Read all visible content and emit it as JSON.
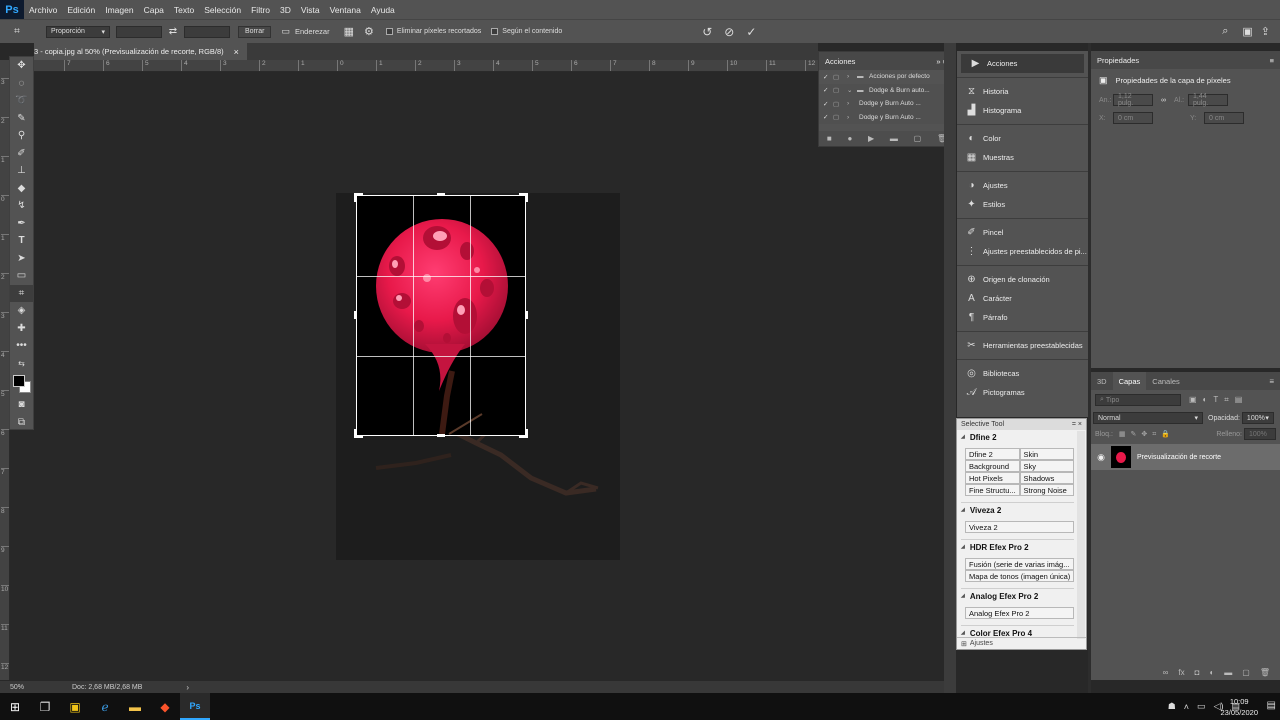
{
  "menubar": {
    "logo": "Ps",
    "items": [
      "Archivo",
      "Edición",
      "Imagen",
      "Capa",
      "Texto",
      "Selección",
      "Filtro",
      "3D",
      "Vista",
      "Ventana",
      "Ayuda"
    ]
  },
  "options": {
    "ratio": "Proporción",
    "clear": "Borrar",
    "straighten": "Enderezar",
    "delete_cropped": "Eliminar píxeles recortados",
    "content_aware": "Según el contenido"
  },
  "document": {
    "tab_title": "3 - copia.jpg al 50% (Previsualización de recorte, RGB/8)",
    "zoom": "50%",
    "doc_info": "Doc: 2,68 MB/2,68 MB"
  },
  "ruler_h": [
    "7",
    "6",
    "5",
    "4",
    "3",
    "2",
    "1",
    "0",
    "1",
    "2",
    "3",
    "4",
    "5",
    "6",
    "7",
    "8",
    "9",
    "10",
    "11",
    "12"
  ],
  "ruler_v": [
    "3",
    "2",
    "1",
    "0",
    "1",
    "2",
    "3",
    "4",
    "5",
    "6",
    "7",
    "8",
    "9",
    "10",
    "11",
    "12"
  ],
  "actions_panel": {
    "title": "Acciones",
    "items": [
      "Acciones por defecto",
      "Dodge & Burn auto...",
      "Dodge y Burn Auto ...",
      "Dodge y Burn Auto ..."
    ]
  },
  "side_panel": {
    "items": [
      {
        "label": "Acciones",
        "icon": "play-icon"
      },
      {
        "label": "Historia",
        "icon": "history-icon"
      },
      {
        "label": "Histograma",
        "icon": "histogram-icon"
      },
      {
        "label": "Color",
        "icon": "color-icon"
      },
      {
        "label": "Muestras",
        "icon": "swatches-icon"
      },
      {
        "label": "Ajustes",
        "icon": "adjustments-icon"
      },
      {
        "label": "Estilos",
        "icon": "styles-icon"
      },
      {
        "label": "Pincel",
        "icon": "brush-icon"
      },
      {
        "label": "Ajustes preestablecidos de pi...",
        "icon": "brush-presets-icon"
      },
      {
        "label": "Origen de clonación",
        "icon": "clone-source-icon"
      },
      {
        "label": "Carácter",
        "icon": "character-icon"
      },
      {
        "label": "Párrafo",
        "icon": "paragraph-icon"
      },
      {
        "label": "Herramientas preestablecidas",
        "icon": "tool-presets-icon"
      },
      {
        "label": "Bibliotecas",
        "icon": "libraries-icon"
      },
      {
        "label": "Pictogramas",
        "icon": "glyphs-icon"
      }
    ]
  },
  "properties": {
    "title": "Propiedades",
    "subtitle": "Propiedades de la capa de píxeles",
    "an_label": "An.:",
    "an_value": "1,12 pulg.",
    "al_label": "Al.:",
    "al_value": "1,44 pulg.",
    "x_label": "X:",
    "x_value": "0 cm",
    "y_label": "Y:",
    "y_value": "0 cm"
  },
  "layers": {
    "tabs": [
      "3D",
      "Capas",
      "Canales"
    ],
    "search": "Tipo",
    "blend": "Normal",
    "opacity_label": "Opacidad:",
    "opacity": "100%",
    "lock_label": "Bloq.:",
    "fill_label": "Relleno:",
    "fill": "100%",
    "layer_name": "Previsualización de recorte"
  },
  "selective_tool": {
    "title": "Selective Tool",
    "footer": "Ajustes",
    "groups": [
      {
        "name": "Dfine 2",
        "buttons": [
          "Dfine 2",
          "Skin",
          "Background",
          "Sky",
          "Hot Pixels",
          "Shadows",
          "Fine Structu...",
          "Strong Noise"
        ],
        "cols": 2
      },
      {
        "name": "Viveza 2",
        "buttons": [
          "Viveza 2"
        ],
        "cols": 1
      },
      {
        "name": "HDR Efex Pro 2",
        "buttons": [
          "Fusión (serie de varias imág...",
          "Mapa de tonos (imagen única)"
        ],
        "cols": 1
      },
      {
        "name": "Analog Efex Pro 2",
        "buttons": [
          "Analog Efex Pro 2"
        ],
        "cols": 1
      },
      {
        "name": "Color Efex Pro 4",
        "buttons": [],
        "cols": 1
      }
    ]
  },
  "taskbar": {
    "time": "10:09",
    "date": "23/05/2020"
  },
  "colors": {
    "accent": "#31a8ff",
    "flower": "#e8194a"
  }
}
